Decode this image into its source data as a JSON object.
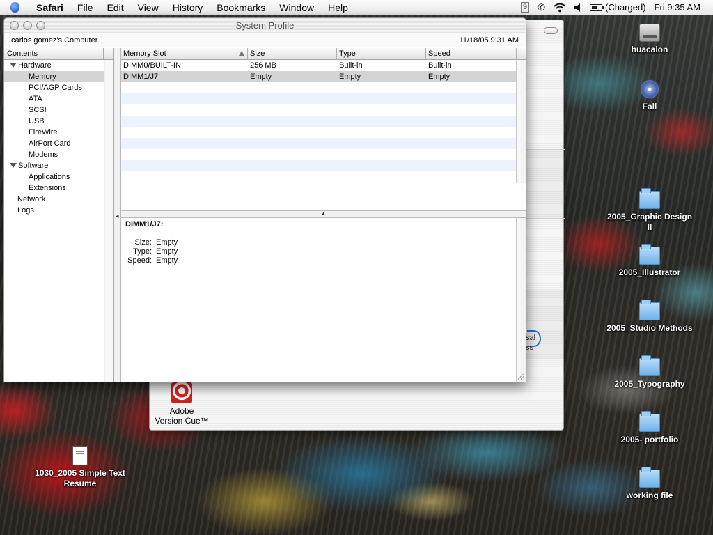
{
  "menubar": {
    "items": [
      "Safari",
      "File",
      "Edit",
      "View",
      "History",
      "Bookmarks",
      "Window",
      "Help"
    ],
    "extras": {
      "badge": "9",
      "battery_status": "(Charged)",
      "clock": "Fri 9:35 AM"
    }
  },
  "background_window": {
    "app_label_1": "Adobe",
    "app_label_2": "Version Cue™",
    "partial_label_1": "sal",
    "partial_label_2": "ss"
  },
  "window": {
    "title": "System Profile",
    "computer_name": "carlos gomez's Computer",
    "timestamp": "11/18/05 9:31 AM",
    "contents_header": "Contents",
    "tree": [
      {
        "label": "Hardware",
        "level": 1,
        "expanded": true
      },
      {
        "label": "Memory",
        "level": 2,
        "selected": true
      },
      {
        "label": "PCI/AGP Cards",
        "level": 2
      },
      {
        "label": "ATA",
        "level": 2
      },
      {
        "label": "SCSI",
        "level": 2
      },
      {
        "label": "USB",
        "level": 2
      },
      {
        "label": "FireWire",
        "level": 2
      },
      {
        "label": "AirPort Card",
        "level": 2
      },
      {
        "label": "Modems",
        "level": 2
      },
      {
        "label": "Software",
        "level": 1,
        "expanded": true
      },
      {
        "label": "Applications",
        "level": 2
      },
      {
        "label": "Extensions",
        "level": 2
      },
      {
        "label": "Network",
        "level": 1
      },
      {
        "label": "Logs",
        "level": 1
      }
    ],
    "table": {
      "columns": [
        "Memory Slot",
        "Size",
        "Type",
        "Speed"
      ],
      "rows": [
        [
          "DIMM0/BUILT-IN",
          "256 MB",
          "Built-in",
          "Built-in"
        ],
        [
          "DIMM1/J7",
          "Empty",
          "Empty",
          "Empty"
        ]
      ]
    },
    "detail": {
      "title": "DIMM1/J7:",
      "fields": [
        {
          "key": "Size:",
          "value": "Empty"
        },
        {
          "key": "Type:",
          "value": "Empty"
        },
        {
          "key": "Speed:",
          "value": "Empty"
        }
      ]
    }
  },
  "desktop_icons": [
    {
      "name": "huacalon",
      "kind": "hd"
    },
    {
      "name": "Fall",
      "kind": "cd"
    },
    {
      "name": "2005_Graphic Design II",
      "kind": "folder"
    },
    {
      "name": "2005_Illustrator",
      "kind": "folder"
    },
    {
      "name": "2005_Studio Methods",
      "kind": "folder"
    },
    {
      "name": "2005_Typography",
      "kind": "folder"
    },
    {
      "name": "2005- portfolio",
      "kind": "folder"
    },
    {
      "name": "working file",
      "kind": "folder"
    },
    {
      "name": "1030_2005 Simple Text Resume",
      "kind": "doc"
    }
  ]
}
